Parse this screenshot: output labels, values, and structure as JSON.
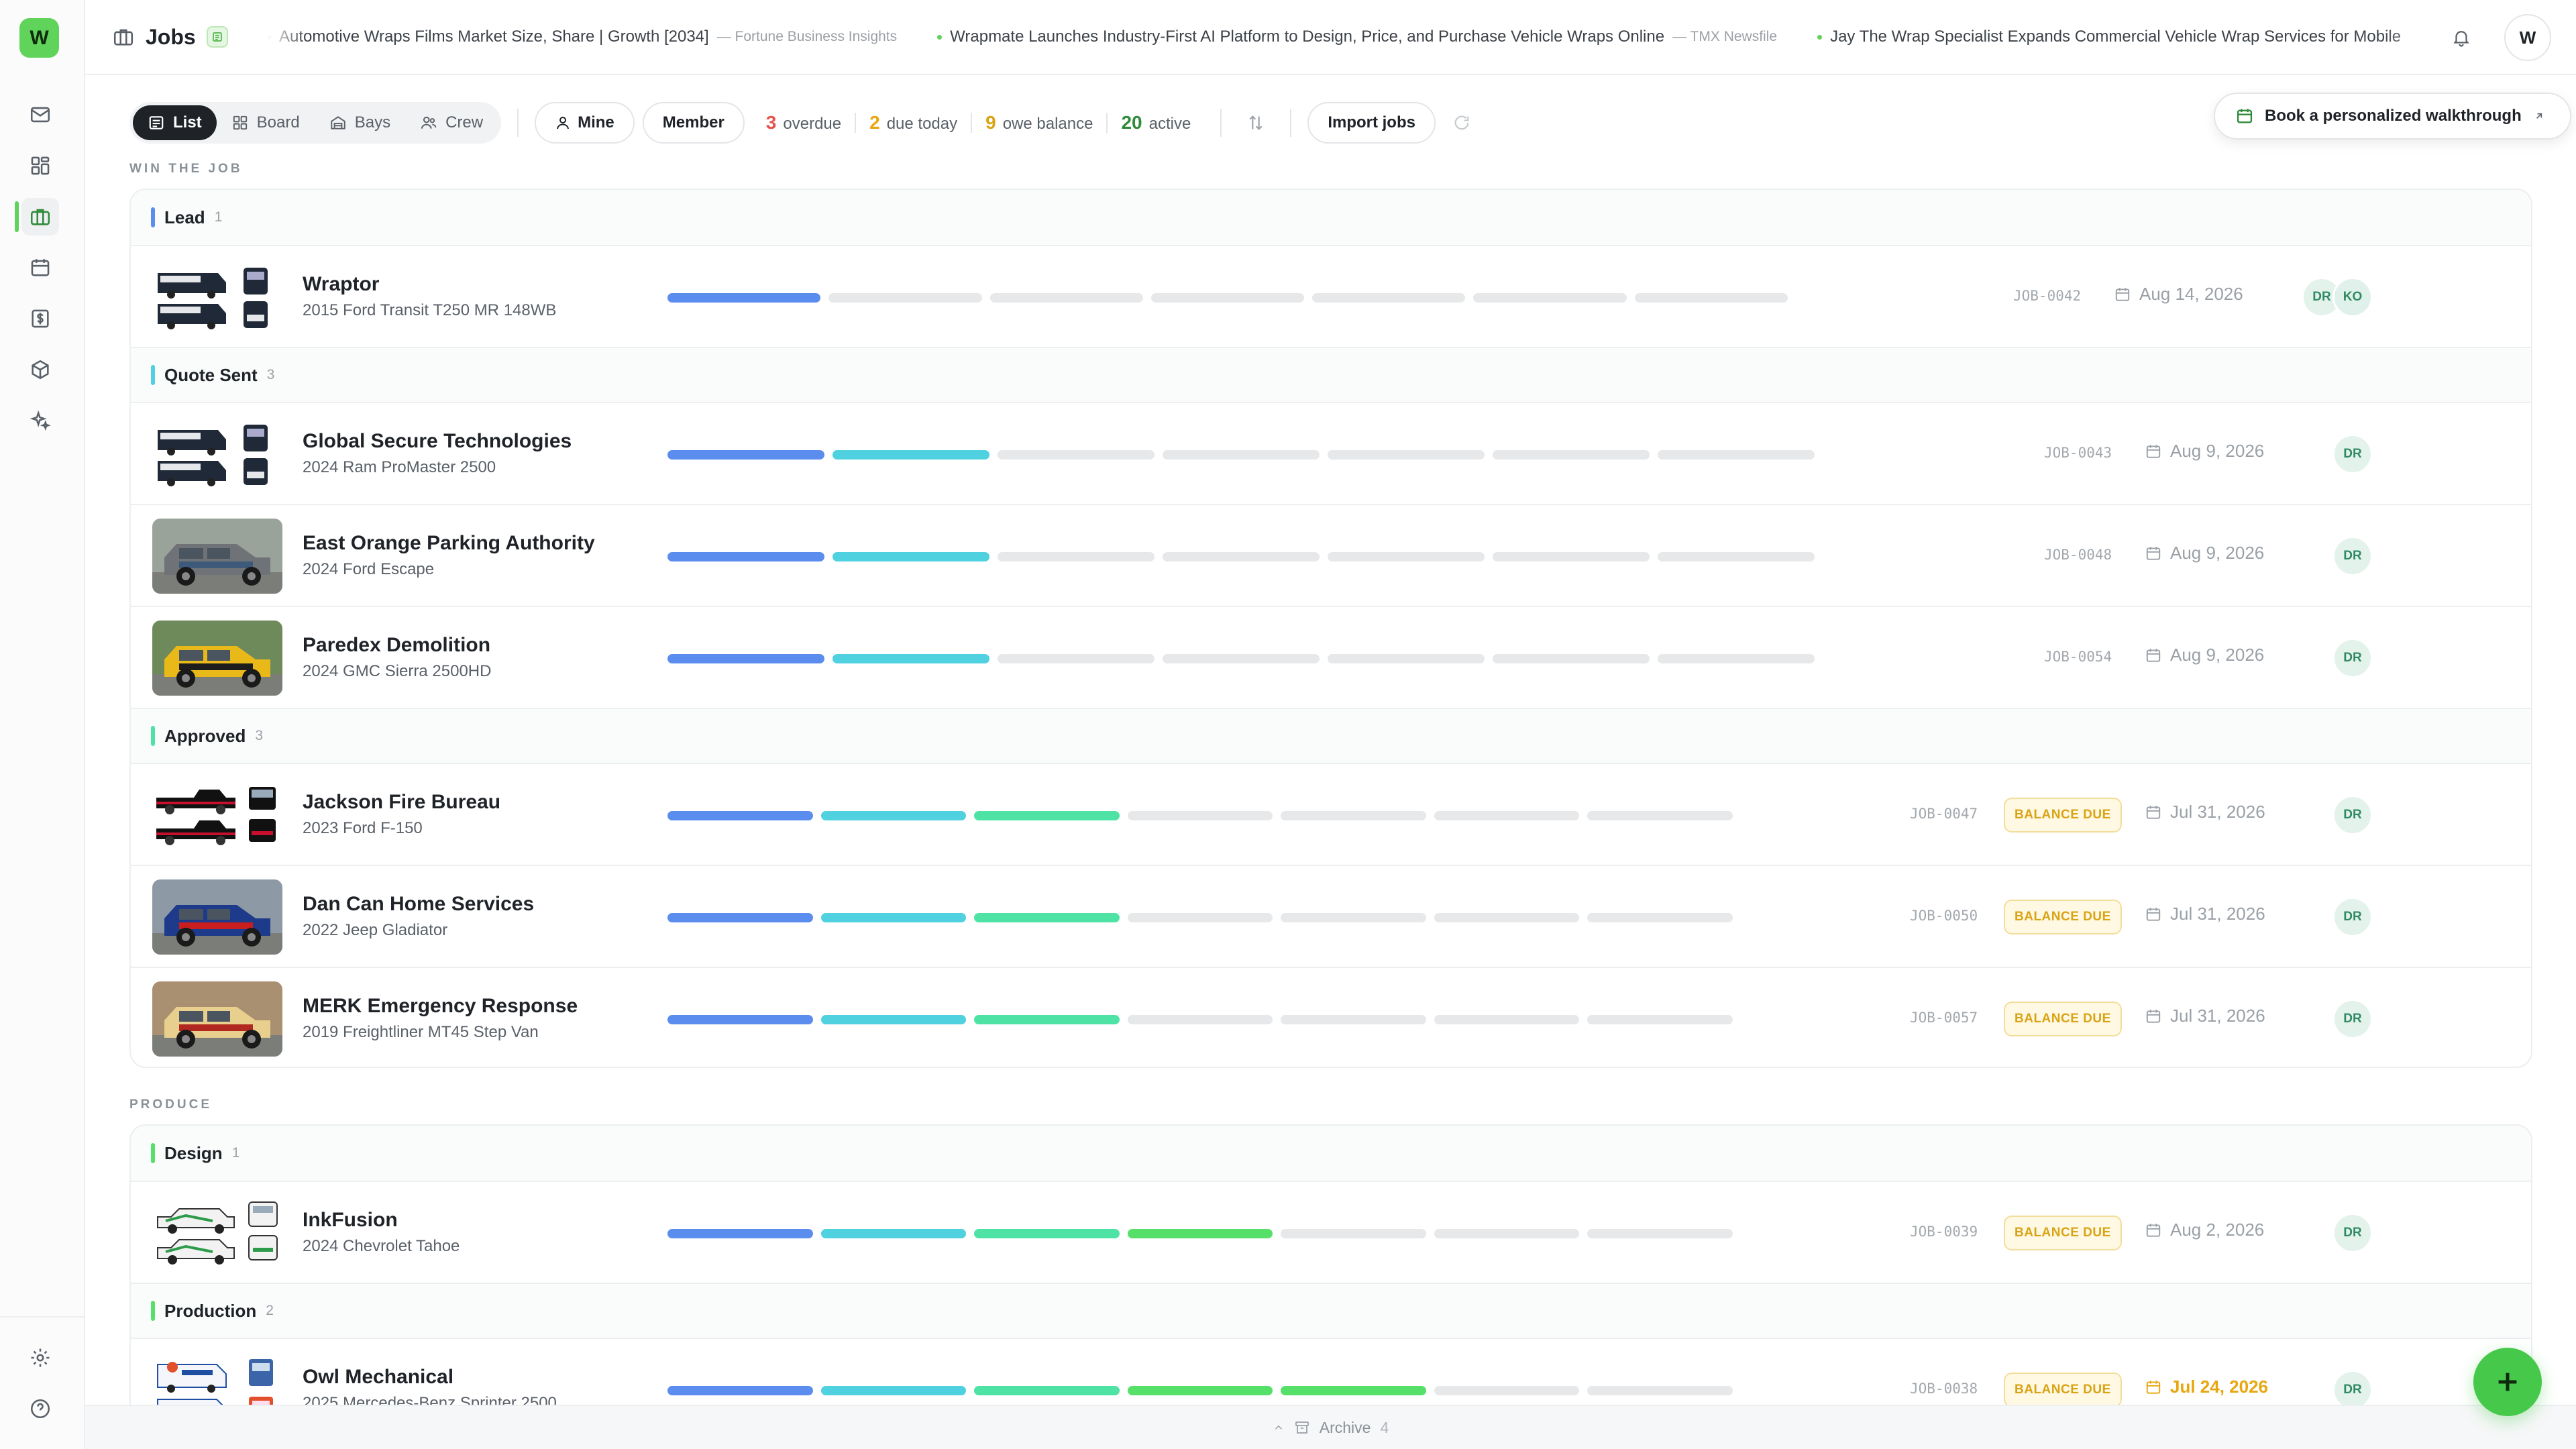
{
  "app": {
    "logo_letter": "W",
    "page_title": "Jobs",
    "user_initial": "W"
  },
  "sidebar": {
    "items": [
      {
        "name": "inbox",
        "icon": "mail-icon",
        "active": false
      },
      {
        "name": "dashboard",
        "icon": "grid-icon",
        "active": false
      },
      {
        "name": "jobs",
        "icon": "briefcase-icon",
        "active": true
      },
      {
        "name": "calendar",
        "icon": "calendar-icon",
        "active": false
      },
      {
        "name": "invoices",
        "icon": "dollar-icon",
        "active": false
      },
      {
        "name": "inventory",
        "icon": "box-icon",
        "active": false
      },
      {
        "name": "ai",
        "icon": "sparkle-icon",
        "active": false
      }
    ],
    "bottom": [
      {
        "name": "settings",
        "icon": "gear-icon"
      },
      {
        "name": "help",
        "icon": "help-icon"
      }
    ]
  },
  "news": [
    {
      "title": "Automotive Wraps Films Market Size, Share | Growth [2034]",
      "source": "— Fortune Business Insights"
    },
    {
      "title": "Wrapmate Launches Industry-First AI Platform to Design, Price, and Purchase Vehicle Wraps Online",
      "source": "— TMX Newsfile"
    },
    {
      "title": "Jay The Wrap Specialist Expands Commercial Vehicle Wrap Services for Mobile",
      "source": ""
    }
  ],
  "toolbar": {
    "views": [
      {
        "label": "List",
        "active": true,
        "icon": "list-icon"
      },
      {
        "label": "Board",
        "active": false,
        "icon": "board-icon"
      },
      {
        "label": "Bays",
        "active": false,
        "icon": "bays-icon"
      },
      {
        "label": "Crew",
        "active": false,
        "icon": "crew-icon"
      }
    ],
    "mine_label": "Mine",
    "member_label": "Member",
    "stats": [
      {
        "count": "3",
        "label": "overdue",
        "color": "#e5534b"
      },
      {
        "count": "2",
        "label": "due today",
        "color": "#e8a60f"
      },
      {
        "count": "9",
        "label": "owe balance",
        "color": "#d9a314"
      },
      {
        "count": "20",
        "label": "active",
        "color": "#2f8a3a"
      }
    ],
    "import_label": "Import jobs",
    "walkthrough_label": "Book a personalized walkthrough"
  },
  "colors": {
    "stage": [
      "#5b8def",
      "#4fd1e0",
      "#4ee3a5",
      "#56e06a",
      "#56e06a",
      "#56e06a",
      "#56e06a"
    ],
    "empty": "#e6e8ea",
    "lead": "#5b8def",
    "quote": "#4fd1e0",
    "approved": "#4ee3a5",
    "design": "#56e06a",
    "production": "#56e06a"
  },
  "sections": [
    {
      "label": "WIN THE JOB",
      "groups": [
        {
          "name": "Lead",
          "count": "1",
          "color": "#5b8def",
          "jobs": [
            {
              "name": "Wraptor",
              "vehicle": "2015 Ford Transit T250 MR 148WB",
              "id": "JOB-0042",
              "date": "Aug 14, 2026",
              "balance": "",
              "avatars": [
                "DR",
                "KO"
              ],
              "progress": {
                "total": 7,
                "filled": 1
              },
              "thumb": "vans"
            }
          ]
        },
        {
          "name": "Quote Sent",
          "count": "3",
          "color": "#4fd1e0",
          "jobs": [
            {
              "name": "Global Secure Technologies",
              "vehicle": "2024 Ram ProMaster 2500",
              "id": "JOB-0043",
              "date": "Aug 9, 2026",
              "balance": "",
              "avatars": [
                "DR"
              ],
              "progress": {
                "total": 7,
                "filled": 2
              },
              "thumb": "vans"
            },
            {
              "name": "East Orange Parking Authority",
              "vehicle": "2024 Ford Escape",
              "id": "JOB-0048",
              "date": "Aug 9, 2026",
              "balance": "",
              "avatars": [
                "DR"
              ],
              "progress": {
                "total": 7,
                "filled": 2
              },
              "thumb": "photo-gray"
            },
            {
              "name": "Paredex Demolition",
              "vehicle": "2024 GMC Sierra 2500HD",
              "id": "JOB-0054",
              "date": "Aug 9, 2026",
              "balance": "",
              "avatars": [
                "DR"
              ],
              "progress": {
                "total": 7,
                "filled": 2
              },
              "thumb": "photo-yellow"
            }
          ]
        },
        {
          "name": "Approved",
          "count": "3",
          "color": "#4ee3a5",
          "jobs": [
            {
              "name": "Jackson Fire Bureau",
              "vehicle": "2023 Ford F-150",
              "id": "JOB-0047",
              "date": "Jul 31, 2026",
              "balance": "BALANCE DUE",
              "avatars": [
                "DR"
              ],
              "progress": {
                "total": 7,
                "filled": 3
              },
              "thumb": "trucks"
            },
            {
              "name": "Dan Can Home Services",
              "vehicle": "2022 Jeep Gladiator",
              "id": "JOB-0050",
              "date": "Jul 31, 2026",
              "balance": "BALANCE DUE",
              "avatars": [
                "DR"
              ],
              "progress": {
                "total": 7,
                "filled": 3
              },
              "thumb": "photo-blue"
            },
            {
              "name": "MERK Emergency Response",
              "vehicle": "2019 Freightliner MT45 Step Van",
              "id": "JOB-0057",
              "date": "Jul 31, 2026",
              "balance": "BALANCE DUE",
              "avatars": [
                "DR"
              ],
              "progress": {
                "total": 7,
                "filled": 3
              },
              "thumb": "photo-tan"
            }
          ]
        }
      ]
    },
    {
      "label": "PRODUCE",
      "groups": [
        {
          "name": "Design",
          "count": "1",
          "color": "#56e06a",
          "jobs": [
            {
              "name": "InkFusion",
              "vehicle": "2024 Chevrolet Tahoe",
              "id": "JOB-0039",
              "date": "Aug 2, 2026",
              "balance": "BALANCE DUE",
              "avatars": [
                "DR"
              ],
              "progress": {
                "total": 7,
                "filled": 4
              },
              "thumb": "suvs"
            }
          ]
        },
        {
          "name": "Production",
          "count": "2",
          "color": "#56e06a",
          "jobs": [
            {
              "name": "Owl Mechanical",
              "vehicle": "2025 Mercedes-Benz Sprinter 2500",
              "id": "JOB-0038",
              "date": "Jul 24, 2026",
              "date_warn": true,
              "balance": "BALANCE DUE",
              "avatars": [
                "DR"
              ],
              "progress": {
                "total": 7,
                "filled": 5
              },
              "thumb": "sprinter"
            }
          ]
        }
      ]
    }
  ],
  "footer": {
    "archive_label": "Archive",
    "archive_count": "4"
  }
}
